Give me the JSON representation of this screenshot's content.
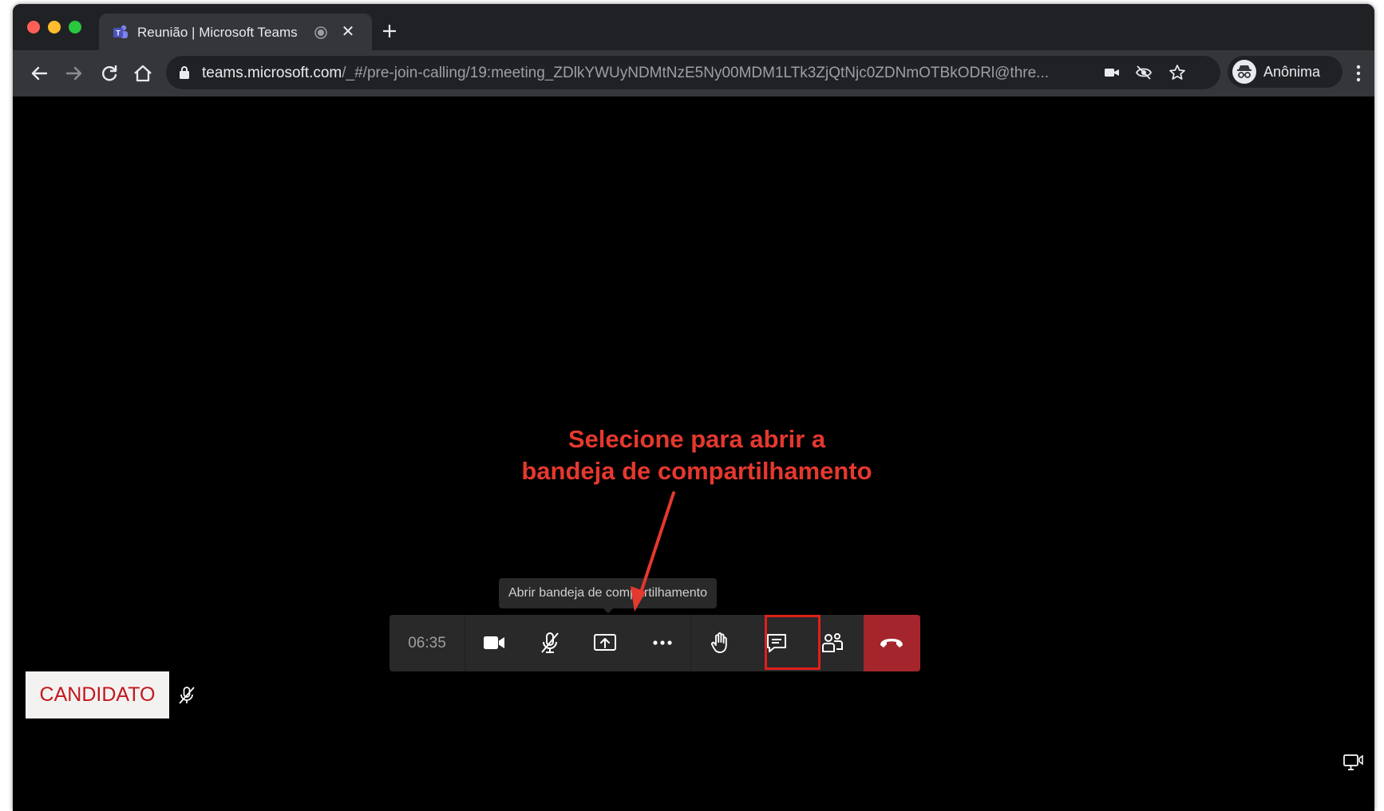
{
  "browser": {
    "tab": {
      "title": "Reunião | Microsoft Teams"
    },
    "address": {
      "host": "teams.microsoft.com",
      "path": "/_#/pre-join-calling/19:meeting_ZDlkYWUyNDMtNzE5Ny00MDM1LTk3ZjQtNjc0ZDNmOTBkODRl@thre..."
    },
    "profile": {
      "name": "Anônima"
    }
  },
  "meeting": {
    "annotation": {
      "line1": "Selecione para abrir a",
      "line2": "bandeja de compartilhamento"
    },
    "tooltip": "Abrir bandeja de compartilhamento",
    "timer": "06:35",
    "participant": {
      "name": "CANDIDATO"
    }
  },
  "colors": {
    "annotation": "#e5382e",
    "highlight_box": "#e0201b",
    "hangup": "#a4262c",
    "name_text": "#c4161c",
    "call_bar": "#292929"
  },
  "icons": {
    "camera": "video-camera-icon",
    "mic": "mic-off-icon",
    "share": "share-tray-icon",
    "more": "more-options-icon",
    "raise_hand": "raise-hand-icon",
    "chat": "chat-icon",
    "participants": "participants-icon",
    "hangup": "hang-up-icon"
  }
}
